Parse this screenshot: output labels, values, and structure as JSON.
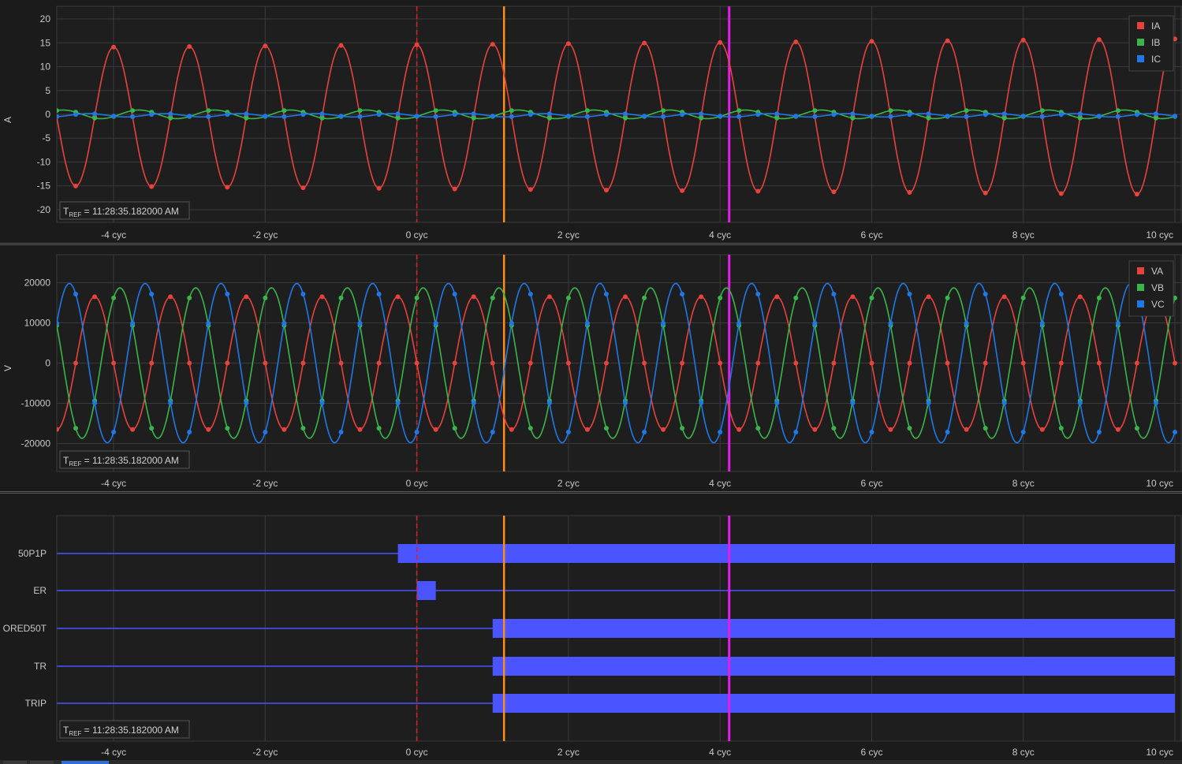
{
  "tref_label": "11:28:35.182000 AM",
  "tref_prefix": "T",
  "tref_sub": "REF",
  "time_axis": {
    "unit_suffix": " cyc",
    "ticks": [
      -4,
      -2,
      0,
      2,
      4,
      6,
      8,
      10
    ],
    "tick_labels": [
      "-4 cyc",
      "-2 cyc",
      "0 cyc",
      "2 cyc",
      "4 cyc",
      "6 cyc",
      "8 cyc",
      "10 cyc"
    ],
    "range": [
      -4.75,
      10.0
    ]
  },
  "cursors": {
    "trigger": {
      "x": 0.0,
      "color": "#e02020",
      "style": "dashed"
    },
    "cursor_a": {
      "x": 1.15,
      "color": "#ff8c1a"
    },
    "cursor_b": {
      "x": 4.12,
      "color": "#e81ce8"
    }
  },
  "chart_data": [
    {
      "type": "line",
      "ylabel": "A",
      "ylim": [
        -21,
        21
      ],
      "yticks": [
        20,
        15,
        10,
        5,
        0,
        -5,
        -10,
        -15,
        -20
      ],
      "legend_placement": "top-right",
      "series": [
        {
          "name": "IA",
          "color": "#e8423d",
          "amplitude": 14.5,
          "amplitude_end": 16.3,
          "phase_deg": 0,
          "offset": -0.5
        },
        {
          "name": "IB",
          "color": "#3ab54a",
          "amplitude": 0.9,
          "amplitude_end": 0.9,
          "phase_deg": 240,
          "offset": 0
        },
        {
          "name": "IC",
          "color": "#1f78e8",
          "amplitude": 0.35,
          "amplitude_end": 0.35,
          "phase_deg": 120,
          "offset": -0.2
        }
      ]
    },
    {
      "type": "line",
      "ylabel": "V",
      "ylim": [
        -25000,
        25000
      ],
      "yticks": [
        20000,
        10000,
        0,
        -10000,
        -20000
      ],
      "legend_placement": "top-right",
      "series": [
        {
          "name": "VA",
          "color": "#e8423d",
          "amplitude": 16500,
          "phase_deg": 90
        },
        {
          "name": "VB",
          "color": "#3ab54a",
          "amplitude": 18700,
          "phase_deg": -30
        },
        {
          "name": "VC",
          "color": "#1f78e8",
          "amplitude": 19800,
          "phase_deg": 210
        }
      ]
    },
    {
      "type": "digital",
      "channels": [
        {
          "name": "50P1P",
          "on": [
            [
              -0.25,
              10.0
            ]
          ]
        },
        {
          "name": "ER",
          "on": [
            [
              0.0,
              0.25
            ]
          ]
        },
        {
          "name": "ORED50T",
          "on": [
            [
              1.0,
              10.0
            ]
          ]
        },
        {
          "name": "TR",
          "on": [
            [
              1.0,
              10.0
            ]
          ]
        },
        {
          "name": "TRIP",
          "on": [
            [
              1.0,
              10.0
            ]
          ]
        }
      ],
      "color": "#4a55ff"
    }
  ]
}
